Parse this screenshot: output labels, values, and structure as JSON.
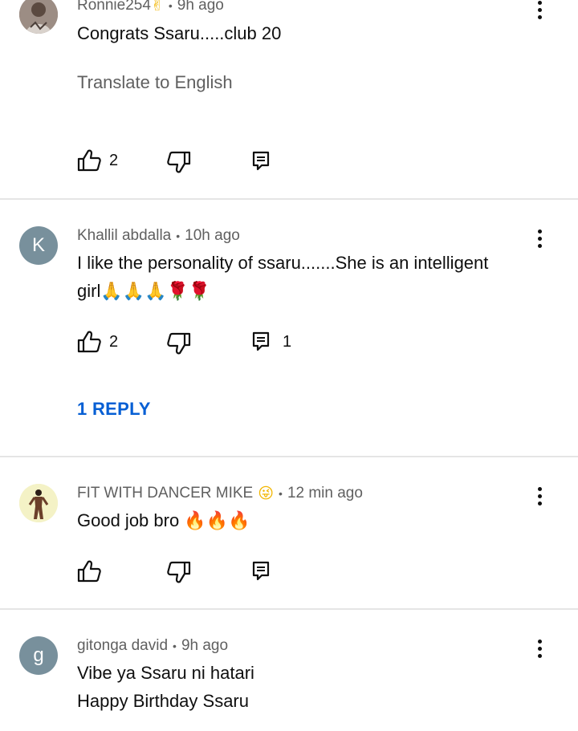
{
  "comments": [
    {
      "author": "Ronnie254",
      "author_emoji": "✌",
      "time": "9h ago",
      "text": "Congrats Ssaru.....club 20",
      "translate": "Translate to English",
      "likes": "2",
      "reply_count": ""
    },
    {
      "author": "Khallil abdalla",
      "avatar_letter": "K",
      "avatar_color": "#78909c",
      "time": "10h ago",
      "text_line1": "I like the personality of ssaru.......She is an intelligent",
      "text_line2": "girl🙏🙏🙏🌹🌹",
      "likes": "2",
      "reply_count": "1",
      "replies_link": "1 REPLY"
    },
    {
      "author": "FIT WITH DANCER MIKE",
      "author_emoji": "😜",
      "time": "12 min ago",
      "text": "Good job bro 🔥🔥🔥",
      "likes": "",
      "reply_count": ""
    },
    {
      "author": "gitonga david",
      "avatar_letter": "g",
      "avatar_color": "#78909c",
      "time": "9h ago",
      "text_line1": "Vibe ya Ssaru ni hatari",
      "text_line2": "Happy Birthday Ssaru"
    }
  ],
  "separator": "•",
  "icons": {
    "like": "thumbs-up-icon",
    "dislike": "thumbs-down-icon",
    "reply": "reply-icon",
    "menu": "more-vert-icon"
  }
}
